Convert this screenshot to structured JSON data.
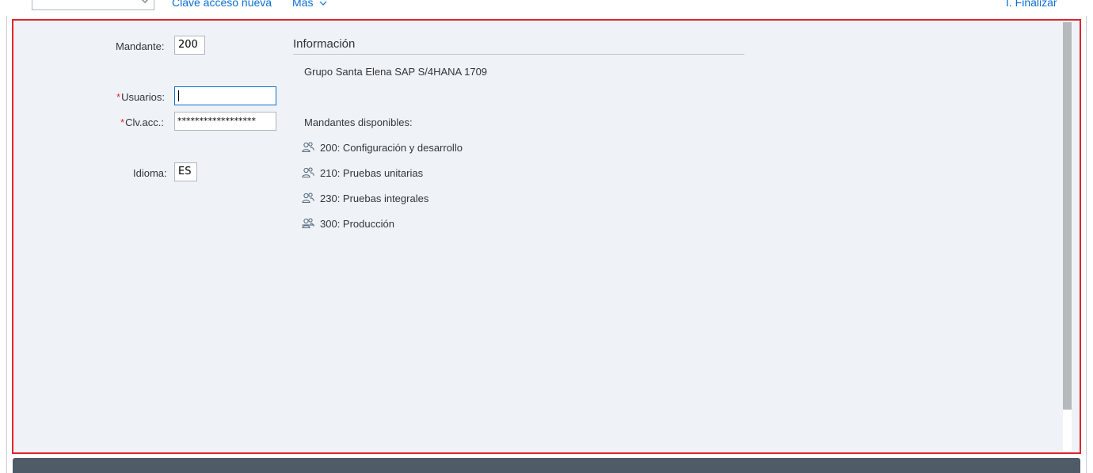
{
  "toolbar": {
    "dropdown_value": "",
    "new_password_link": "Clave acceso nueva",
    "more_menu": "Más",
    "exit_link": "I. Finalizar"
  },
  "login": {
    "client_label": "Mandante:",
    "client_value": "200",
    "user_label": "Usuarios:",
    "user_value": "",
    "password_label": "Clv.acc.:",
    "password_value": "******************",
    "language_label": "Idioma:",
    "language_value": "ES",
    "required_marker": "*"
  },
  "info": {
    "title": "Información",
    "system_name": "Grupo Santa Elena SAP S/4HANA 1709",
    "clients_header": "Mandantes disponibles:",
    "clients": [
      {
        "label": "200: Configuración y desarrollo",
        "icon": "users-icon"
      },
      {
        "label": "210: Pruebas unitarias",
        "icon": "users-icon"
      },
      {
        "label": "230: Pruebas integrales",
        "icon": "users-icon"
      },
      {
        "label": "300: Producción",
        "icon": "users-crossed-icon"
      }
    ]
  },
  "colors": {
    "panel_bg": "#eff3f7",
    "highlight_border": "#e0242b",
    "link": "#0a6ed1",
    "footer": "#4f5b66"
  }
}
